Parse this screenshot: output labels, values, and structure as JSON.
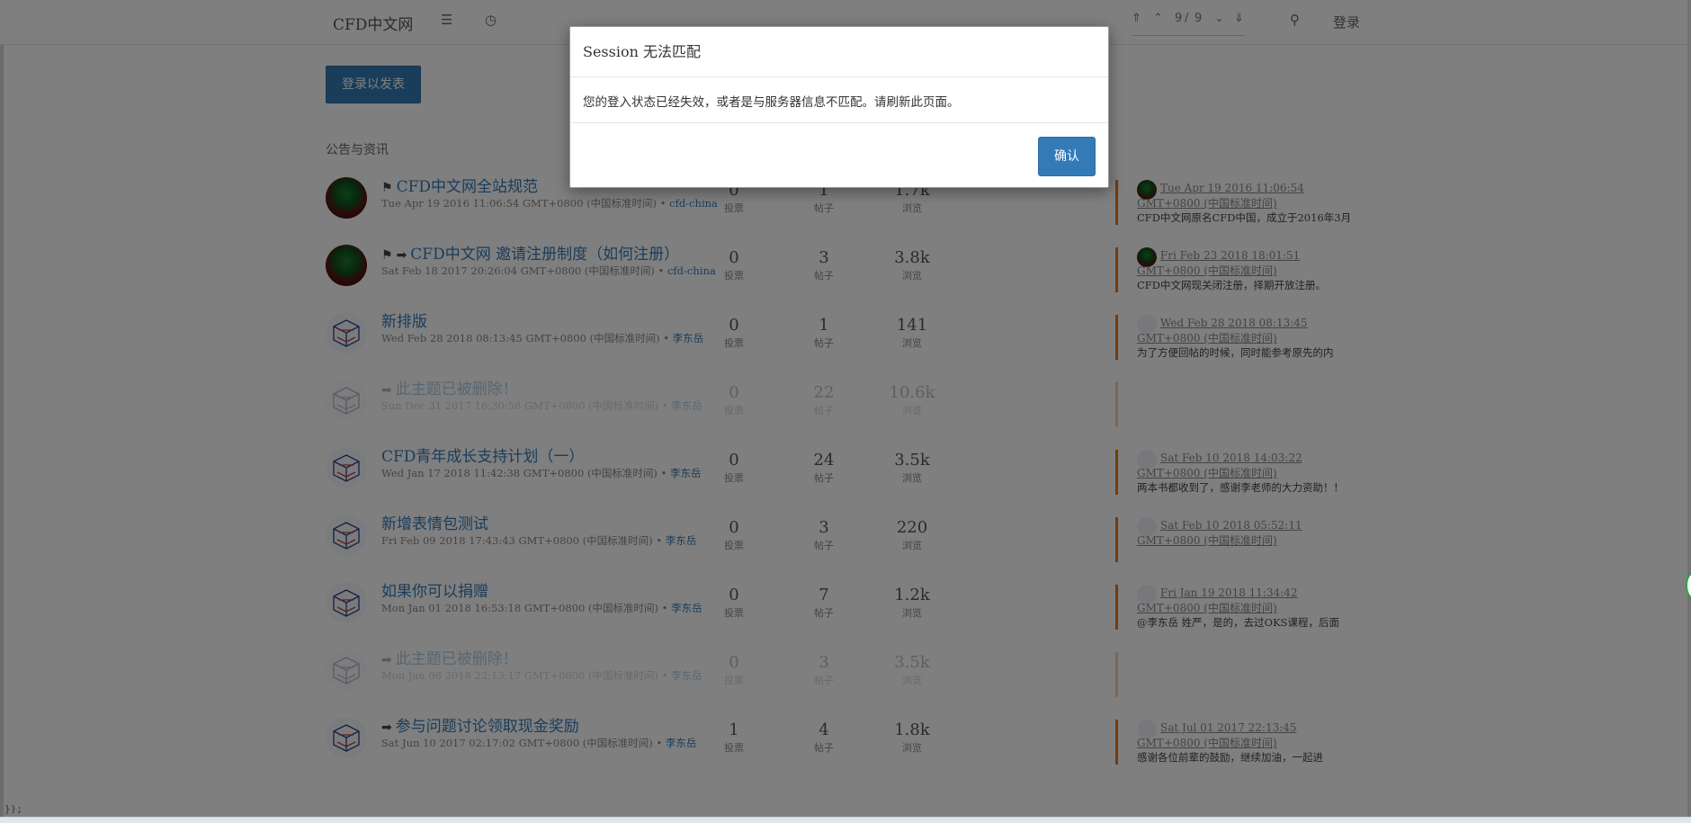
{
  "header": {
    "brand": "CFD中文网",
    "pager": {
      "current": "9",
      "sep": "/",
      "total": "9"
    },
    "login": "登录"
  },
  "composer": {
    "label": "登录以发表"
  },
  "category": {
    "title": "公告与资讯"
  },
  "topics": [
    {
      "title": "CFD中文网全站规范",
      "pinned": true,
      "moved": false,
      "date": "Tue Apr 19 2016 11:06:54 GMT+0800 (中国标准时间)",
      "bullet": "•",
      "author": "cfd-china",
      "votes": "0",
      "posts": "1",
      "views": "1.7k",
      "votes_label": "投票",
      "posts_label": "帖子",
      "views_label": "浏览",
      "last_time": "Tue Apr 19 2016 11:06:54 GMT+0800 (中国标准时间)",
      "last_snippet": "CFD中文网原名CFD中国，成立于2016年3月",
      "avatar": "bottle",
      "deleted": false
    },
    {
      "title": "CFD中文网 邀请注册制度（如何注册）",
      "pinned": true,
      "moved": true,
      "date": "Sat Feb 18 2017 20:26:04 GMT+0800 (中国标准时间)",
      "bullet": "•",
      "author": "cfd-china",
      "votes": "0",
      "posts": "3",
      "views": "3.8k",
      "votes_label": "投票",
      "posts_label": "帖子",
      "views_label": "浏览",
      "last_time": "Fri Feb 23 2018 18:01:51 GMT+0800 (中国标准时间)",
      "last_snippet": "CFD中文网现关闭注册，择期开放注册。",
      "avatar": "bottle",
      "deleted": false
    },
    {
      "title": "新排版",
      "pinned": false,
      "moved": false,
      "date": "Wed Feb 28 2018 08:13:45 GMT+0800 (中国标准时间)",
      "bullet": "•",
      "author": "李东岳",
      "votes": "0",
      "posts": "1",
      "views": "141",
      "votes_label": "投票",
      "posts_label": "帖子",
      "views_label": "浏览",
      "last_time": "Wed Feb 28 2018 08:13:45 GMT+0800 (中国标准时间)",
      "last_snippet": "为了方便回帖的时候，同时能参考原先的内",
      "avatar": "mesh",
      "deleted": false
    },
    {
      "title": "此主题已被删除！",
      "pinned": false,
      "moved": true,
      "date": "Sun Dec 31 2017 16:30:58 GMT+0800 (中国标准时间)",
      "bullet": "•",
      "author": "李东岳",
      "votes": "0",
      "posts": "22",
      "views": "10.6k",
      "votes_label": "投票",
      "posts_label": "帖子",
      "views_label": "浏览",
      "last_time": "",
      "last_snippet": "",
      "avatar": "mesh",
      "deleted": true
    },
    {
      "title": "CFD青年成长支持计划（一）",
      "pinned": false,
      "moved": false,
      "date": "Wed Jan 17 2018 11:42:38 GMT+0800 (中国标准时间)",
      "bullet": "•",
      "author": "李东岳",
      "votes": "0",
      "posts": "24",
      "views": "3.5k",
      "votes_label": "投票",
      "posts_label": "帖子",
      "views_label": "浏览",
      "last_time": "Sat Feb 10 2018 14:03:22 GMT+0800 (中国标准时间)",
      "last_snippet": "两本书都收到了，感谢李老师的大力资助！！",
      "avatar": "mesh",
      "deleted": false
    },
    {
      "title": "新增表情包测试",
      "pinned": false,
      "moved": false,
      "date": "Fri Feb 09 2018 17:43:43 GMT+0800 (中国标准时间)",
      "bullet": "•",
      "author": "李东岳",
      "votes": "0",
      "posts": "3",
      "views": "220",
      "votes_label": "投票",
      "posts_label": "帖子",
      "views_label": "浏览",
      "last_time": "Sat Feb 10 2018 05:52:11 GMT+0800 (中国标准时间)",
      "last_snippet": "",
      "avatar": "mesh",
      "deleted": false
    },
    {
      "title": "如果你可以捐赠",
      "pinned": false,
      "moved": false,
      "date": "Mon Jan 01 2018 16:53:18 GMT+0800 (中国标准时间)",
      "bullet": "•",
      "author": "李东岳",
      "votes": "0",
      "posts": "7",
      "views": "1.2k",
      "votes_label": "投票",
      "posts_label": "帖子",
      "views_label": "浏览",
      "last_time": "Fri Jan 19 2018 11:34:42 GMT+0800 (中国标准时间)",
      "last_snippet": "@李东岳 姓严，是的，去过OKS课程，后面",
      "avatar": "mesh",
      "deleted": false
    },
    {
      "title": "此主题已被删除！",
      "pinned": false,
      "moved": true,
      "date": "Mon Jan 08 2018 22:13:17 GMT+0800 (中国标准时间)",
      "bullet": "•",
      "author": "李东岳",
      "votes": "0",
      "posts": "3",
      "views": "3.5k",
      "votes_label": "投票",
      "posts_label": "帖子",
      "views_label": "浏览",
      "last_time": "",
      "last_snippet": "",
      "avatar": "mesh",
      "deleted": true
    },
    {
      "title": "参与问题讨论领取现金奖励",
      "pinned": false,
      "moved": true,
      "date": "Sat Jun 10 2017 02:17:02 GMT+0800 (中国标准时间)",
      "bullet": "•",
      "author": "李东岳",
      "votes": "1",
      "posts": "4",
      "views": "1.8k",
      "votes_label": "投票",
      "posts_label": "帖子",
      "views_label": "浏览",
      "last_time": "Sat Jul 01 2017 22:13:45 GMT+0800 (中国标准时间)",
      "last_snippet": "感谢各位前辈的鼓励，继续加油，一起进",
      "avatar": "mesh",
      "deleted": false
    }
  ],
  "page_footer_text": "});",
  "modal": {
    "title": "Session 无法匹配",
    "body": "您的登入状态已经失效，或者是与服务器信息不匹配。请刷新此页面。",
    "confirm": "确认"
  },
  "colors": {
    "accent": "#337ab7",
    "last_post_border": "#e07b1a",
    "overlay": "rgba(0,0,0,0.5)"
  }
}
